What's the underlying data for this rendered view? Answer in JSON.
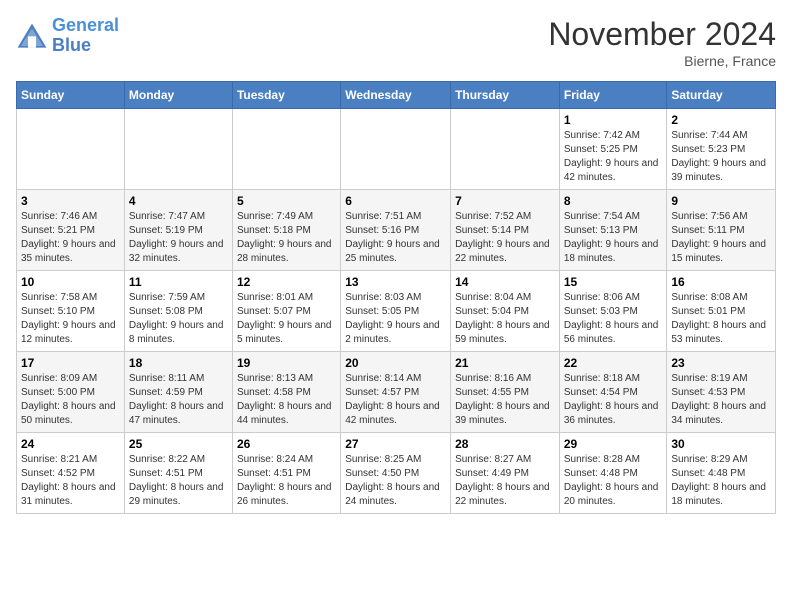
{
  "logo": {
    "line1": "General",
    "line2": "Blue"
  },
  "title": "November 2024",
  "location": "Bierne, France",
  "weekdays": [
    "Sunday",
    "Monday",
    "Tuesday",
    "Wednesday",
    "Thursday",
    "Friday",
    "Saturday"
  ],
  "weeks": [
    [
      {
        "day": "",
        "info": ""
      },
      {
        "day": "",
        "info": ""
      },
      {
        "day": "",
        "info": ""
      },
      {
        "day": "",
        "info": ""
      },
      {
        "day": "",
        "info": ""
      },
      {
        "day": "1",
        "info": "Sunrise: 7:42 AM\nSunset: 5:25 PM\nDaylight: 9 hours and 42 minutes."
      },
      {
        "day": "2",
        "info": "Sunrise: 7:44 AM\nSunset: 5:23 PM\nDaylight: 9 hours and 39 minutes."
      }
    ],
    [
      {
        "day": "3",
        "info": "Sunrise: 7:46 AM\nSunset: 5:21 PM\nDaylight: 9 hours and 35 minutes."
      },
      {
        "day": "4",
        "info": "Sunrise: 7:47 AM\nSunset: 5:19 PM\nDaylight: 9 hours and 32 minutes."
      },
      {
        "day": "5",
        "info": "Sunrise: 7:49 AM\nSunset: 5:18 PM\nDaylight: 9 hours and 28 minutes."
      },
      {
        "day": "6",
        "info": "Sunrise: 7:51 AM\nSunset: 5:16 PM\nDaylight: 9 hours and 25 minutes."
      },
      {
        "day": "7",
        "info": "Sunrise: 7:52 AM\nSunset: 5:14 PM\nDaylight: 9 hours and 22 minutes."
      },
      {
        "day": "8",
        "info": "Sunrise: 7:54 AM\nSunset: 5:13 PM\nDaylight: 9 hours and 18 minutes."
      },
      {
        "day": "9",
        "info": "Sunrise: 7:56 AM\nSunset: 5:11 PM\nDaylight: 9 hours and 15 minutes."
      }
    ],
    [
      {
        "day": "10",
        "info": "Sunrise: 7:58 AM\nSunset: 5:10 PM\nDaylight: 9 hours and 12 minutes."
      },
      {
        "day": "11",
        "info": "Sunrise: 7:59 AM\nSunset: 5:08 PM\nDaylight: 9 hours and 8 minutes."
      },
      {
        "day": "12",
        "info": "Sunrise: 8:01 AM\nSunset: 5:07 PM\nDaylight: 9 hours and 5 minutes."
      },
      {
        "day": "13",
        "info": "Sunrise: 8:03 AM\nSunset: 5:05 PM\nDaylight: 9 hours and 2 minutes."
      },
      {
        "day": "14",
        "info": "Sunrise: 8:04 AM\nSunset: 5:04 PM\nDaylight: 8 hours and 59 minutes."
      },
      {
        "day": "15",
        "info": "Sunrise: 8:06 AM\nSunset: 5:03 PM\nDaylight: 8 hours and 56 minutes."
      },
      {
        "day": "16",
        "info": "Sunrise: 8:08 AM\nSunset: 5:01 PM\nDaylight: 8 hours and 53 minutes."
      }
    ],
    [
      {
        "day": "17",
        "info": "Sunrise: 8:09 AM\nSunset: 5:00 PM\nDaylight: 8 hours and 50 minutes."
      },
      {
        "day": "18",
        "info": "Sunrise: 8:11 AM\nSunset: 4:59 PM\nDaylight: 8 hours and 47 minutes."
      },
      {
        "day": "19",
        "info": "Sunrise: 8:13 AM\nSunset: 4:58 PM\nDaylight: 8 hours and 44 minutes."
      },
      {
        "day": "20",
        "info": "Sunrise: 8:14 AM\nSunset: 4:57 PM\nDaylight: 8 hours and 42 minutes."
      },
      {
        "day": "21",
        "info": "Sunrise: 8:16 AM\nSunset: 4:55 PM\nDaylight: 8 hours and 39 minutes."
      },
      {
        "day": "22",
        "info": "Sunrise: 8:18 AM\nSunset: 4:54 PM\nDaylight: 8 hours and 36 minutes."
      },
      {
        "day": "23",
        "info": "Sunrise: 8:19 AM\nSunset: 4:53 PM\nDaylight: 8 hours and 34 minutes."
      }
    ],
    [
      {
        "day": "24",
        "info": "Sunrise: 8:21 AM\nSunset: 4:52 PM\nDaylight: 8 hours and 31 minutes."
      },
      {
        "day": "25",
        "info": "Sunrise: 8:22 AM\nSunset: 4:51 PM\nDaylight: 8 hours and 29 minutes."
      },
      {
        "day": "26",
        "info": "Sunrise: 8:24 AM\nSunset: 4:51 PM\nDaylight: 8 hours and 26 minutes."
      },
      {
        "day": "27",
        "info": "Sunrise: 8:25 AM\nSunset: 4:50 PM\nDaylight: 8 hours and 24 minutes."
      },
      {
        "day": "28",
        "info": "Sunrise: 8:27 AM\nSunset: 4:49 PM\nDaylight: 8 hours and 22 minutes."
      },
      {
        "day": "29",
        "info": "Sunrise: 8:28 AM\nSunset: 4:48 PM\nDaylight: 8 hours and 20 minutes."
      },
      {
        "day": "30",
        "info": "Sunrise: 8:29 AM\nSunset: 4:48 PM\nDaylight: 8 hours and 18 minutes."
      }
    ]
  ]
}
